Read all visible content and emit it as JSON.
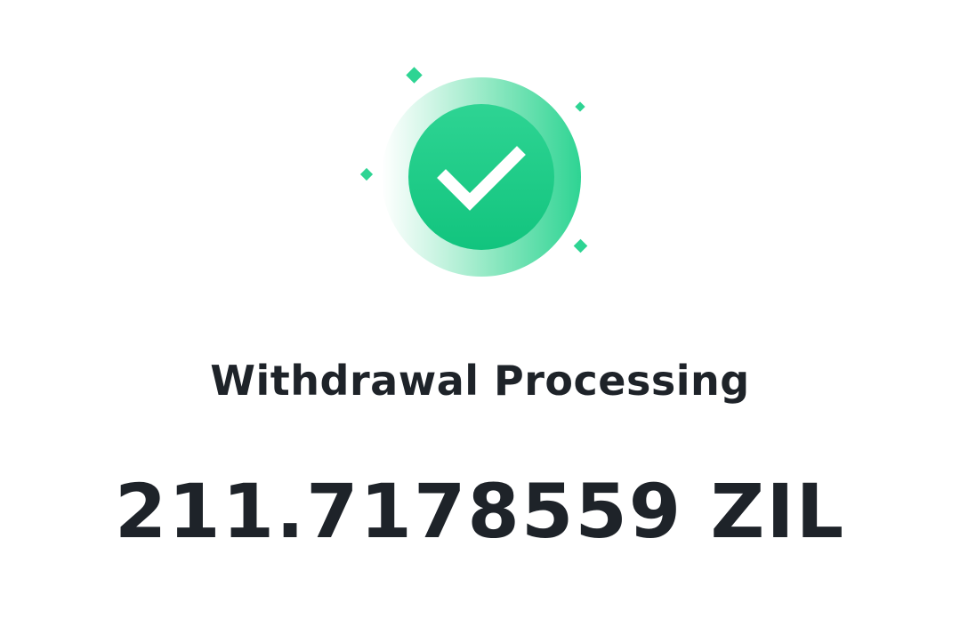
{
  "status": {
    "title": "Withdrawal Processing",
    "icon": "success-check-icon",
    "accent_color": "#0ecb81"
  },
  "withdrawal": {
    "amount": "211.7178559",
    "currency": "ZIL"
  }
}
